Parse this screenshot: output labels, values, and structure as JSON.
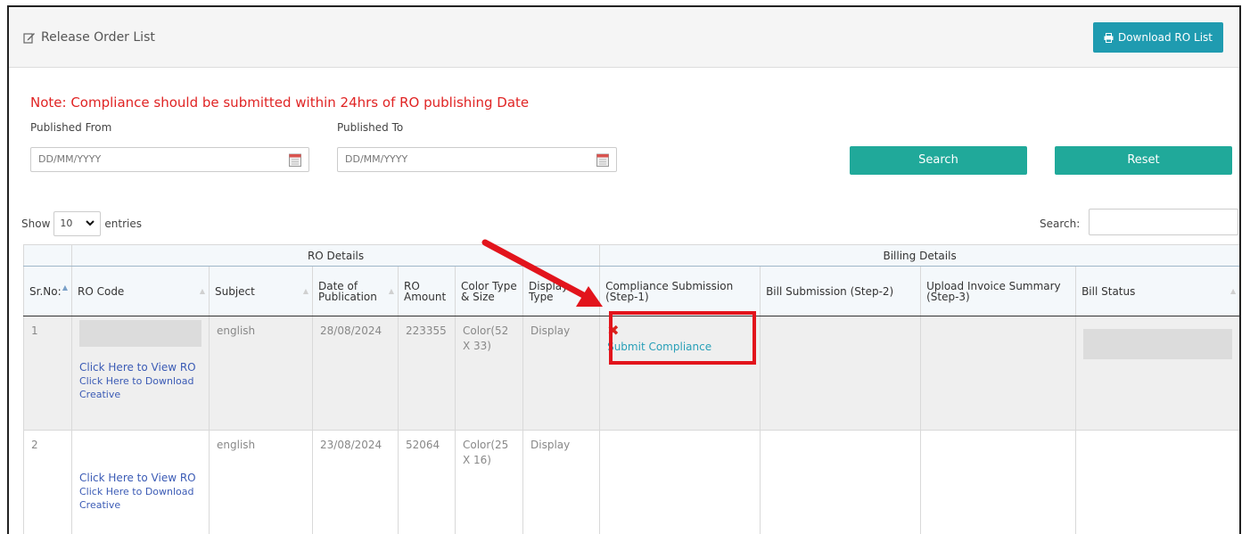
{
  "header": {
    "title": "Release Order List",
    "download_label": "Download RO List"
  },
  "filters": {
    "note": "Note: Compliance should be submitted within 24hrs of RO publishing Date",
    "from_label": "Published From",
    "to_label": "Published To",
    "from_placeholder": "DD/MM/YYYY",
    "to_placeholder": "DD/MM/YYYY",
    "search_label": "Search",
    "reset_label": "Reset"
  },
  "table_controls": {
    "show_label": "Show",
    "entries_value": "10",
    "entries_label": "entries",
    "search_label": "Search:"
  },
  "table": {
    "groups": [
      "RO Details",
      "Billing Details"
    ],
    "columns": [
      "Sr.No:",
      "RO Code",
      "Subject",
      "Date of Publication",
      "RO Amount",
      "Color Type & Size",
      "Display Type",
      "Compliance Submission (Step-1)",
      "Bill Submission (Step-2)",
      "Upload Invoice Summary (Step-3)",
      "Bill Status"
    ],
    "rows": [
      {
        "sr": "1",
        "view_ro": "Click Here to View RO",
        "download_creative": "Click Here to Download Creative",
        "subject": "english",
        "date": "28/08/2024",
        "amount": "223355",
        "color_size": "Color(52 X 33)",
        "display_type": "Display",
        "compliance_link": "Submit Compliance"
      },
      {
        "sr": "2",
        "view_ro": "Click Here to View RO",
        "download_creative": "Click Here to Download Creative",
        "subject": "english",
        "date": "23/08/2024",
        "amount": "52064",
        "color_size": "Color(25 X 16)",
        "display_type": "Display"
      }
    ]
  },
  "colors": {
    "accent_teal": "#20a99a",
    "download_blue": "#1f9bb0",
    "note_red": "#e02424",
    "highlight_red": "#e2141c"
  },
  "icons": [
    "edit-icon",
    "print-icon",
    "calendar-icon",
    "chevron-down-icon",
    "close-icon",
    "sort-icon"
  ]
}
